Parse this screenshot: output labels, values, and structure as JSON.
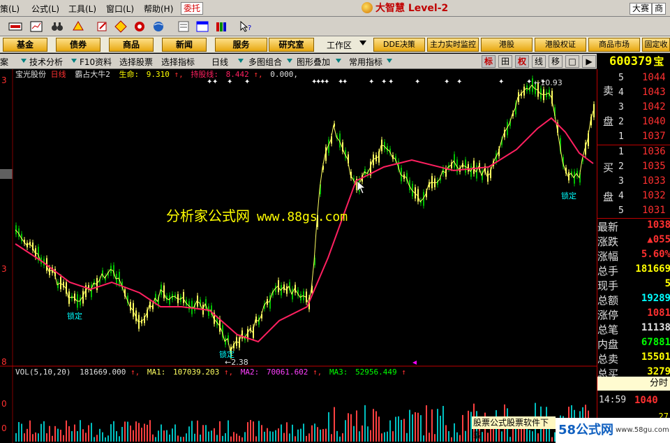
{
  "menubar": {
    "items": [
      "策(L)",
      "公式(L)",
      "工具(L)",
      "窗口(L)",
      "帮助(H)"
    ],
    "delegate": "委托",
    "title": "大智慧 Level-2",
    "right_tags": [
      "大赛",
      "商"
    ]
  },
  "navbar": {
    "buttons": [
      "基金",
      "债券",
      "商品",
      "新闻",
      "服务",
      "研究室"
    ],
    "workzone": "工作区",
    "right_buttons": [
      "DDE决策",
      "主力实时监控",
      "港股",
      "港股权证",
      "商品市场",
      "固定收"
    ]
  },
  "funcbar": {
    "items": [
      "案",
      "技术分析",
      "F10资料",
      "选择股票",
      "选择指标",
      "日线",
      "多图组合",
      "图形叠加",
      "常用指标"
    ],
    "right_buttons": [
      "标",
      "田",
      "权",
      "线",
      "移",
      "□",
      "▶"
    ],
    "stock_code": "600379",
    "stock_tail": "宝"
  },
  "chart": {
    "stock_name": "宝光股份",
    "period": "日线",
    "indicator_name": "霸占大牛2",
    "life_label": "生命:",
    "life_value": "9.310",
    "hold_label": "持股线:",
    "hold_value": "8.442",
    "extra_value": "0.000,",
    "high_label": "10.93",
    "low_label": "2.38",
    "lock_label": "锁定",
    "watermark_cn": "分析家公式网",
    "watermark_url": "www.88gs.com",
    "vol_label": "VOL(5,10,20)",
    "vol_value": "181669.000",
    "ma1_label": "MA1:",
    "ma1_value": "107039.203",
    "ma2_label": "MA2:",
    "ma2_value": "70061.602",
    "ma3_label": "MA3:",
    "ma3_value": "52956.449",
    "left_axis_top": "3",
    "left_axis_mid": "3",
    "left_axis_bot": "8",
    "vol_axis_top": "0",
    "vol_axis_bot": "0"
  },
  "orderbook": {
    "sell_side_label": [
      "卖",
      "盘"
    ],
    "buy_side_label": [
      "买",
      "盘"
    ],
    "sell": [
      {
        "level": "5",
        "price": "1044"
      },
      {
        "level": "4",
        "price": "1043"
      },
      {
        "level": "3",
        "price": "1042"
      },
      {
        "level": "2",
        "price": "1040"
      },
      {
        "level": "1",
        "price": "1037"
      }
    ],
    "buy": [
      {
        "level": "1",
        "price": "1036"
      },
      {
        "level": "2",
        "price": "1035"
      },
      {
        "level": "3",
        "price": "1033"
      },
      {
        "level": "4",
        "price": "1032"
      },
      {
        "level": "5",
        "price": "1031"
      }
    ]
  },
  "stats": [
    {
      "label": "最新",
      "value": "1038",
      "color": "#ff3030"
    },
    {
      "label": "涨跌",
      "value": "▲055",
      "color": "#ff3030"
    },
    {
      "label": "涨幅",
      "value": "5.60%",
      "color": "#ff3030"
    },
    {
      "label": "总手",
      "value": "181669",
      "color": "#ffff00"
    },
    {
      "label": "现手",
      "value": "5",
      "color": "#ffff00"
    },
    {
      "label": "总额",
      "value": "19289",
      "color": "#00ffff"
    },
    {
      "label": "涨停",
      "value": "1081",
      "color": "#ff3030"
    },
    {
      "label": "总笔",
      "value": "11138",
      "color": "#e0e0e0"
    },
    {
      "label": "内盘",
      "value": "67881",
      "color": "#00ff00"
    },
    {
      "label": "总卖",
      "value": "15501",
      "color": "#ffff00"
    },
    {
      "label": "总买",
      "value": "3279",
      "color": "#ffff00"
    }
  ],
  "timeshare": {
    "label": "分时",
    "time": "14:59",
    "price": "1040",
    "vol": "27"
  },
  "overlays": {
    "download_banner": "股票公式股票软件下载",
    "brand": "58公式网",
    "brand_url": "www.58gu.com"
  },
  "colors": {
    "up": "#ff3030",
    "ma_pink": "#ff2060",
    "ma_yellow": "#ffff60",
    "candle_green": "#00c000",
    "text_cyan": "#00ffff"
  }
}
